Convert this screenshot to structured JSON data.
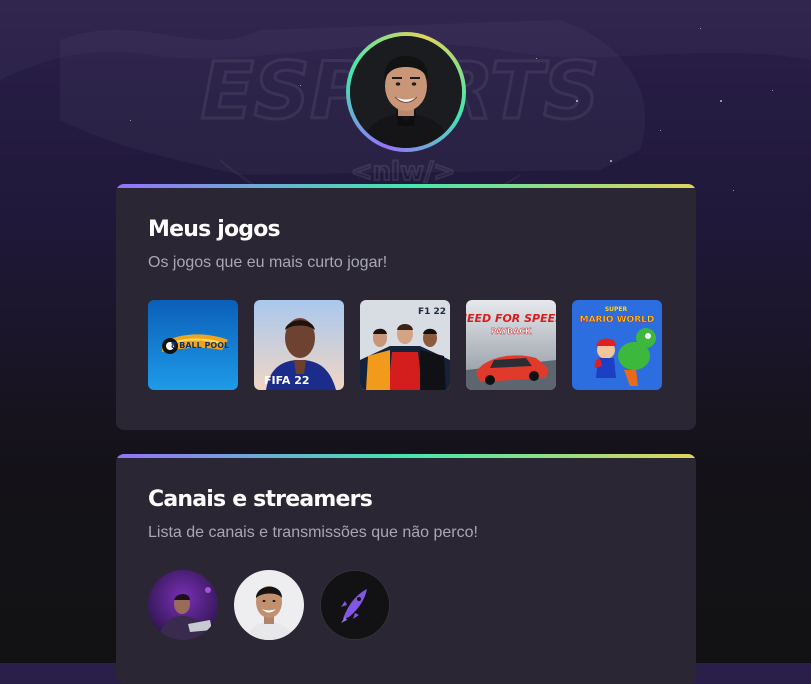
{
  "background": {
    "logo_text": "ESPORTS",
    "logo_subtext": "<nlw/>"
  },
  "profile": {
    "avatar_icon": "profile-photo"
  },
  "games_section": {
    "title": "Meus jogos",
    "subtitle": "Os jogos que eu mais curto jogar!",
    "games": [
      {
        "label": "8 Ball Pool",
        "logo_text": "8 BALL POOL",
        "color": "#1a7fd1"
      },
      {
        "label": "FIFA 22",
        "logo_text": "FIFA 22",
        "color": "#b9cde8"
      },
      {
        "label": "F1 22",
        "logo_text": "F1 22",
        "color": "#1b2a40"
      },
      {
        "label": "Need for Speed Payback",
        "logo_text": "NEED FOR SPEED",
        "sub_text": "PAYBACK",
        "color": "#c9cfd6"
      },
      {
        "label": "Super Mario World",
        "logo_text": "MARIO WORLD",
        "super_text": "SUPER",
        "color": "#2c6de0"
      }
    ]
  },
  "channels_section": {
    "title": "Canais e streamers",
    "subtitle": "Lista de canais e transmissões que não perco!",
    "channels": [
      {
        "icon": "streamer-avatar-purple"
      },
      {
        "icon": "streamer-avatar-smiling"
      },
      {
        "icon": "rocketseat-rocket-logo",
        "color": "#8257e5"
      }
    ]
  },
  "colors": {
    "card_bg": "#2a2634",
    "gradient_start": "#9572fc",
    "gradient_mid": "#43e7ad",
    "gradient_end": "#e2d45c",
    "subtitle": "#a8a8b3"
  }
}
